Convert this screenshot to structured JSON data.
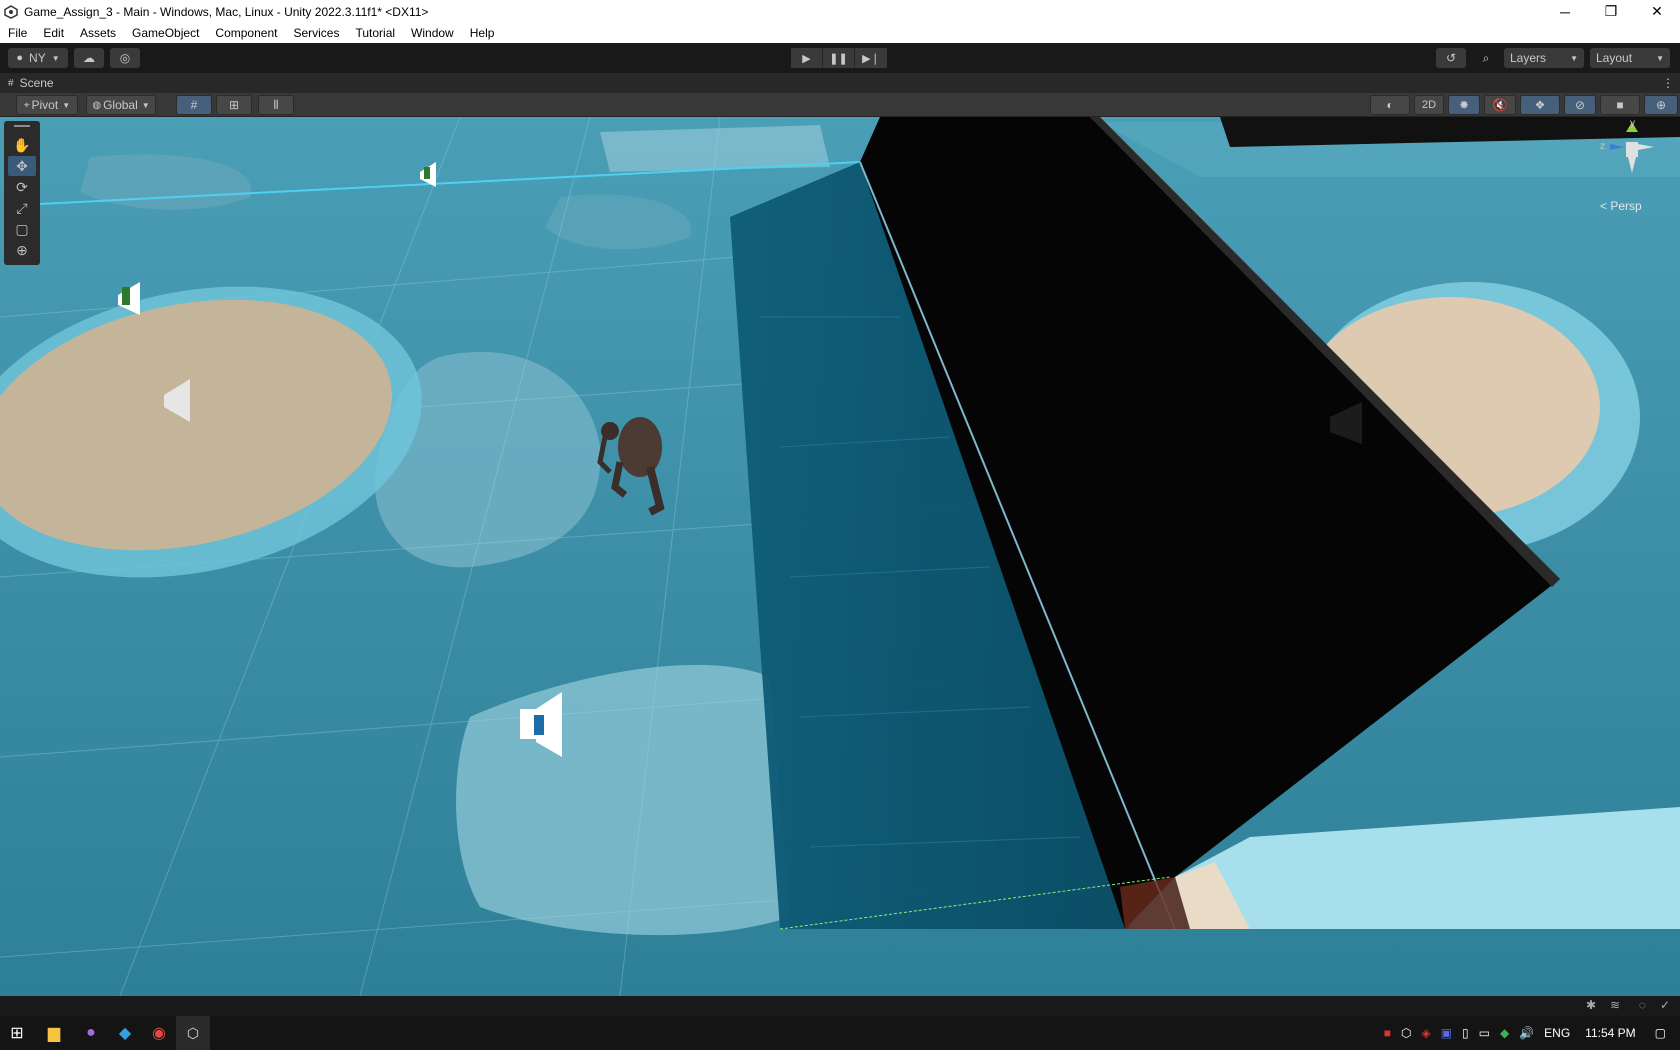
{
  "window": {
    "title": "Game_Assign_3 - Main - Windows, Mac, Linux - Unity 2022.3.11f1* <DX11>",
    "minimize": "─",
    "restore": "❐",
    "close": "✕"
  },
  "menu": [
    "File",
    "Edit",
    "Assets",
    "GameObject",
    "Component",
    "Services",
    "Tutorial",
    "Window",
    "Help"
  ],
  "toolbar": {
    "account": "NY",
    "layers": "Layers",
    "layout": "Layout"
  },
  "scene_tab": {
    "label": "Scene"
  },
  "scene_toolbar": {
    "pivot": "Pivot",
    "global": "Global",
    "mode_2d": "2D"
  },
  "gizmo": {
    "y": "y",
    "z": "z",
    "persp": "< Persp"
  },
  "taskbar": {
    "language": "ENG",
    "time": "11:54 PM"
  },
  "colors": {
    "water": "#3a8fa7",
    "sand": "#c4b49a",
    "block": "#050505",
    "panel": "#383838",
    "accent": "#46607c"
  }
}
